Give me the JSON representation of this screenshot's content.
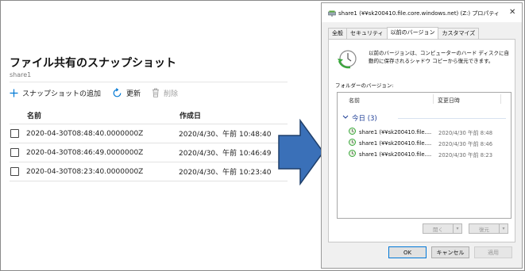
{
  "portal": {
    "title": "ファイル共有のスナップショット",
    "subtitle": "share1",
    "commands": {
      "add_label": "スナップショットの追加",
      "refresh_label": "更新",
      "delete_label": "削除"
    },
    "columns": {
      "name": "名前",
      "created": "作成日"
    },
    "rows": [
      {
        "name": "2020-04-30T08:48:40.0000000Z",
        "created": "2020/4/30、午前 10:48:40"
      },
      {
        "name": "2020-04-30T08:46:49.0000000Z",
        "created": "2020/4/30、午前 10:46:49"
      },
      {
        "name": "2020-04-30T08:23:40.0000000Z",
        "created": "2020/4/30、午前 10:23:40"
      }
    ]
  },
  "dialog": {
    "title": "share1 (¥¥sk200410.file.core.windows.net) (Z:) プロパティ",
    "close": "✕",
    "tabs": [
      "全般",
      "セキュリティ",
      "以前のバージョン",
      "カスタマイズ"
    ],
    "info": "以前のバージョンは、コンピューターのハード ディスクに自動的に保存されるシャドウ コピーから復元できます。",
    "folder_versions_label": "フォルダーのバージョン:",
    "list": {
      "col_name": "名前",
      "col_modified": "変更日時",
      "group": "今日 (3)",
      "items": [
        {
          "name": "share1 (¥¥sk200410.file....",
          "date": "2020/4/30 午前 8:48"
        },
        {
          "name": "share1 (¥¥sk200410.file....",
          "date": "2020/4/30 午前 8:46"
        },
        {
          "name": "share1 (¥¥sk200410.file....",
          "date": "2020/4/30 午前 8:23"
        }
      ]
    },
    "open_label": "開く",
    "restore_label": "復元",
    "ok_label": "OK",
    "cancel_label": "キャンセル",
    "apply_label": "適用"
  },
  "colors": {
    "accent": "#0078d4",
    "arrow": "#3a70b8",
    "arrow_border": "#1f3f6a",
    "group": "#1e3e96"
  },
  "icons": {
    "add": "plus-icon",
    "refresh": "refresh-icon",
    "delete": "trash-icon",
    "arrow": "right-arrow-icon",
    "restore": "restore-clock-icon",
    "drive": "network-drive-icon"
  }
}
